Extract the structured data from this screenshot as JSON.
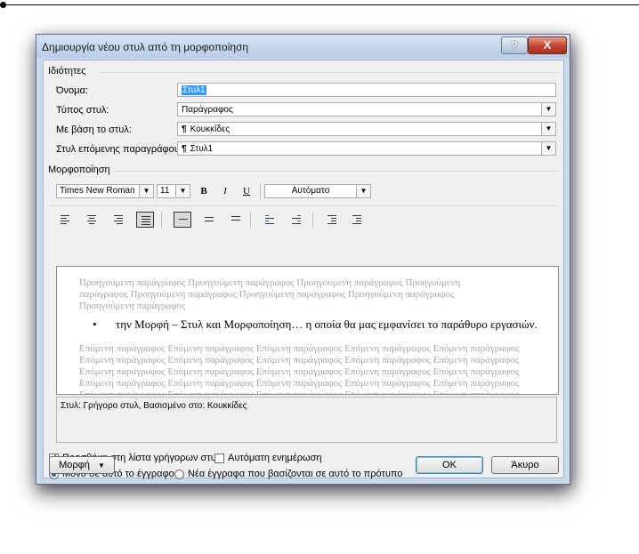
{
  "dialog": {
    "title": "Δημιουργία νέου στυλ από τη μορφοποίηση",
    "help_label": "?",
    "close_label": "X"
  },
  "properties": {
    "section_label": "Ιδιότητες",
    "name_label": "Όνομα:",
    "name_value": "Στυλ1",
    "style_type_label": "Τύπος στυλ:",
    "style_type_value": "Παράγραφος",
    "based_on_label": "Με βάση το στυλ:",
    "based_on_value": "Κουκκίδες",
    "next_para_label": "Στυλ επόμενης παραγράφου:",
    "next_para_value": "Στυλ1",
    "paragraph_symbol": "¶"
  },
  "formatting": {
    "section_label": "Μορφοποίηση",
    "font": "Times New Roman",
    "size": "11",
    "bold": "B",
    "italic": "I",
    "underline": "U",
    "color": "Αυτόματο"
  },
  "preview": {
    "previous": "Προηγούμενη παράγραφος Προηγούμενη παράγραφος Προηγούμενη παράγραφος Προηγούμενη παράγραφος Προηγούμενη παράγραφος Προηγούμενη παράγραφος Προηγούμενη παράγραφος Προηγούμενη παράγραφος",
    "bullet": "•",
    "main_text": "την Μορφή – Στυλ και Μορφοποίηση… η οποία θα μας εμφανίσει το παράθυρο εργασιών.",
    "following": "Επόμενη παράγραφος Επόμενη παράγραφος Επόμενη παράγραφος Επόμενη παράγραφος Επόμενη παράγραφος Επόμενη παράγραφος Επόμενη παράγραφος Επόμενη παράγραφος Επόμενη παράγραφος Επόμενη παράγραφος Επόμενη παράγραφος Επόμενη παράγραφος Επόμενη παράγραφος Επόμενη παράγραφος Επόμενη παράγραφος Επόμενη παράγραφος Επόμενη παράγραφος Επόμενη παράγραφος Επόμενη παράγραφος Επόμενη παράγραφος Επόμενη παράγραφος Επόμενη παράγραφος Επόμενη παράγραφος Επόμενη παράγραφος Επόμενη παράγραφος Επόμενη παράγραφος Επόμενη παράγραφος Επόμενη παράγραφος Επόμενη παράγραφος Επόμενη παράγραφος"
  },
  "description": "Στυλ: Γρήγορο στυλ, Βασισμένο στο: Κουκκίδες",
  "options": {
    "add_quick_styles": "Προσθήκη στη λίστα γρήγορων στυλ",
    "add_quick_styles_checked": true,
    "auto_update": "Αυτόματη ενημέρωση",
    "auto_update_checked": false,
    "only_this_doc": "Μόνο σε αυτό το έγγραφο",
    "new_docs": "Νέα έγγραφα που βασίζονται σε αυτό το πρότυπο",
    "selected_scope": "only_this_doc"
  },
  "buttons": {
    "format": "Μορφή",
    "ok": "OK",
    "cancel": "Άκυρο"
  }
}
